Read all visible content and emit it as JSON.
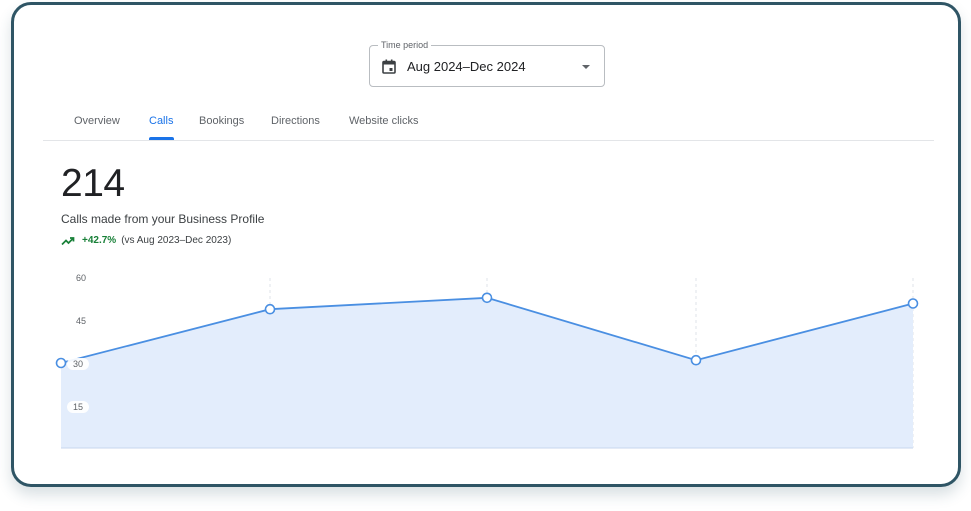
{
  "filter": {
    "legend": "Time period",
    "value": "Aug 2024–Dec 2024"
  },
  "tabs": [
    {
      "label": "Overview"
    },
    {
      "label": "Calls"
    },
    {
      "label": "Bookings"
    },
    {
      "label": "Directions"
    },
    {
      "label": "Website clicks"
    }
  ],
  "active_tab": "Calls",
  "metric": {
    "value": "214",
    "description": "Calls made from your Business Profile",
    "change": "+42.7%",
    "comparison": "(vs Aug 2023–Dec 2023)"
  },
  "colors": {
    "accent": "#1a73e8",
    "positive": "#188038",
    "frame": "#2f5565",
    "area_fill": "#e3edfc",
    "line": "#4a8fe2"
  },
  "chart_data": {
    "type": "area",
    "y_ticks": [
      "60",
      "45",
      "30",
      "15"
    ],
    "ylim": [
      0,
      60
    ],
    "series": [
      {
        "values": [
          30,
          49,
          53,
          31,
          51
        ]
      }
    ],
    "grid": "vertical dashed",
    "markers": "hollow circles"
  }
}
